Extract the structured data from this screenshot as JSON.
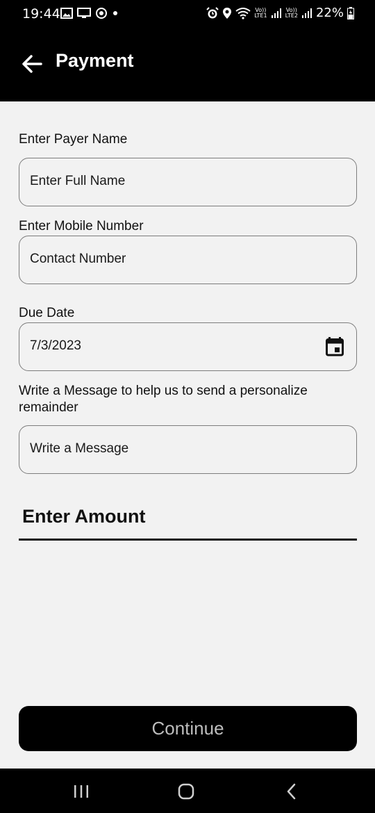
{
  "status_bar": {
    "time": "19:44",
    "battery": "22%",
    "lte1": [
      "Vo))",
      "LTE1"
    ],
    "lte2": [
      "Vo))",
      "LTE2"
    ],
    "left_icons": [
      "gallery-icon",
      "screen-cast-icon",
      "sync-icon",
      "dot-icon"
    ],
    "right_icons": [
      "alarm-icon",
      "location-icon",
      "wifi-icon",
      "signal-icon",
      "signal-icon",
      "battery-charging-icon"
    ]
  },
  "header": {
    "title": "Payment",
    "back_icon": "back-arrow-icon"
  },
  "form": {
    "payer_name": {
      "label": "Enter Payer Name",
      "placeholder": "Enter Full Name"
    },
    "mobile": {
      "label": "Enter Mobile Number",
      "placeholder": "Contact Number"
    },
    "due_date": {
      "label": "Due Date",
      "value": "7/3/2023",
      "icon": "calendar-icon"
    },
    "message": {
      "label": "Write a Message to help us to send a personalize remainder",
      "placeholder": "Write a Message"
    },
    "amount": {
      "label": "Enter Amount"
    }
  },
  "continue_button": {
    "label": "Continue"
  },
  "nav_bar": {
    "icons": [
      "recent-apps-icon",
      "home-icon",
      "back-icon"
    ]
  },
  "colors": {
    "header_bg": "#000000",
    "page_bg": "#f2f2f2",
    "button_bg": "#000000",
    "button_text": "#bdbdbd",
    "field_border": "#7d7d7d"
  }
}
